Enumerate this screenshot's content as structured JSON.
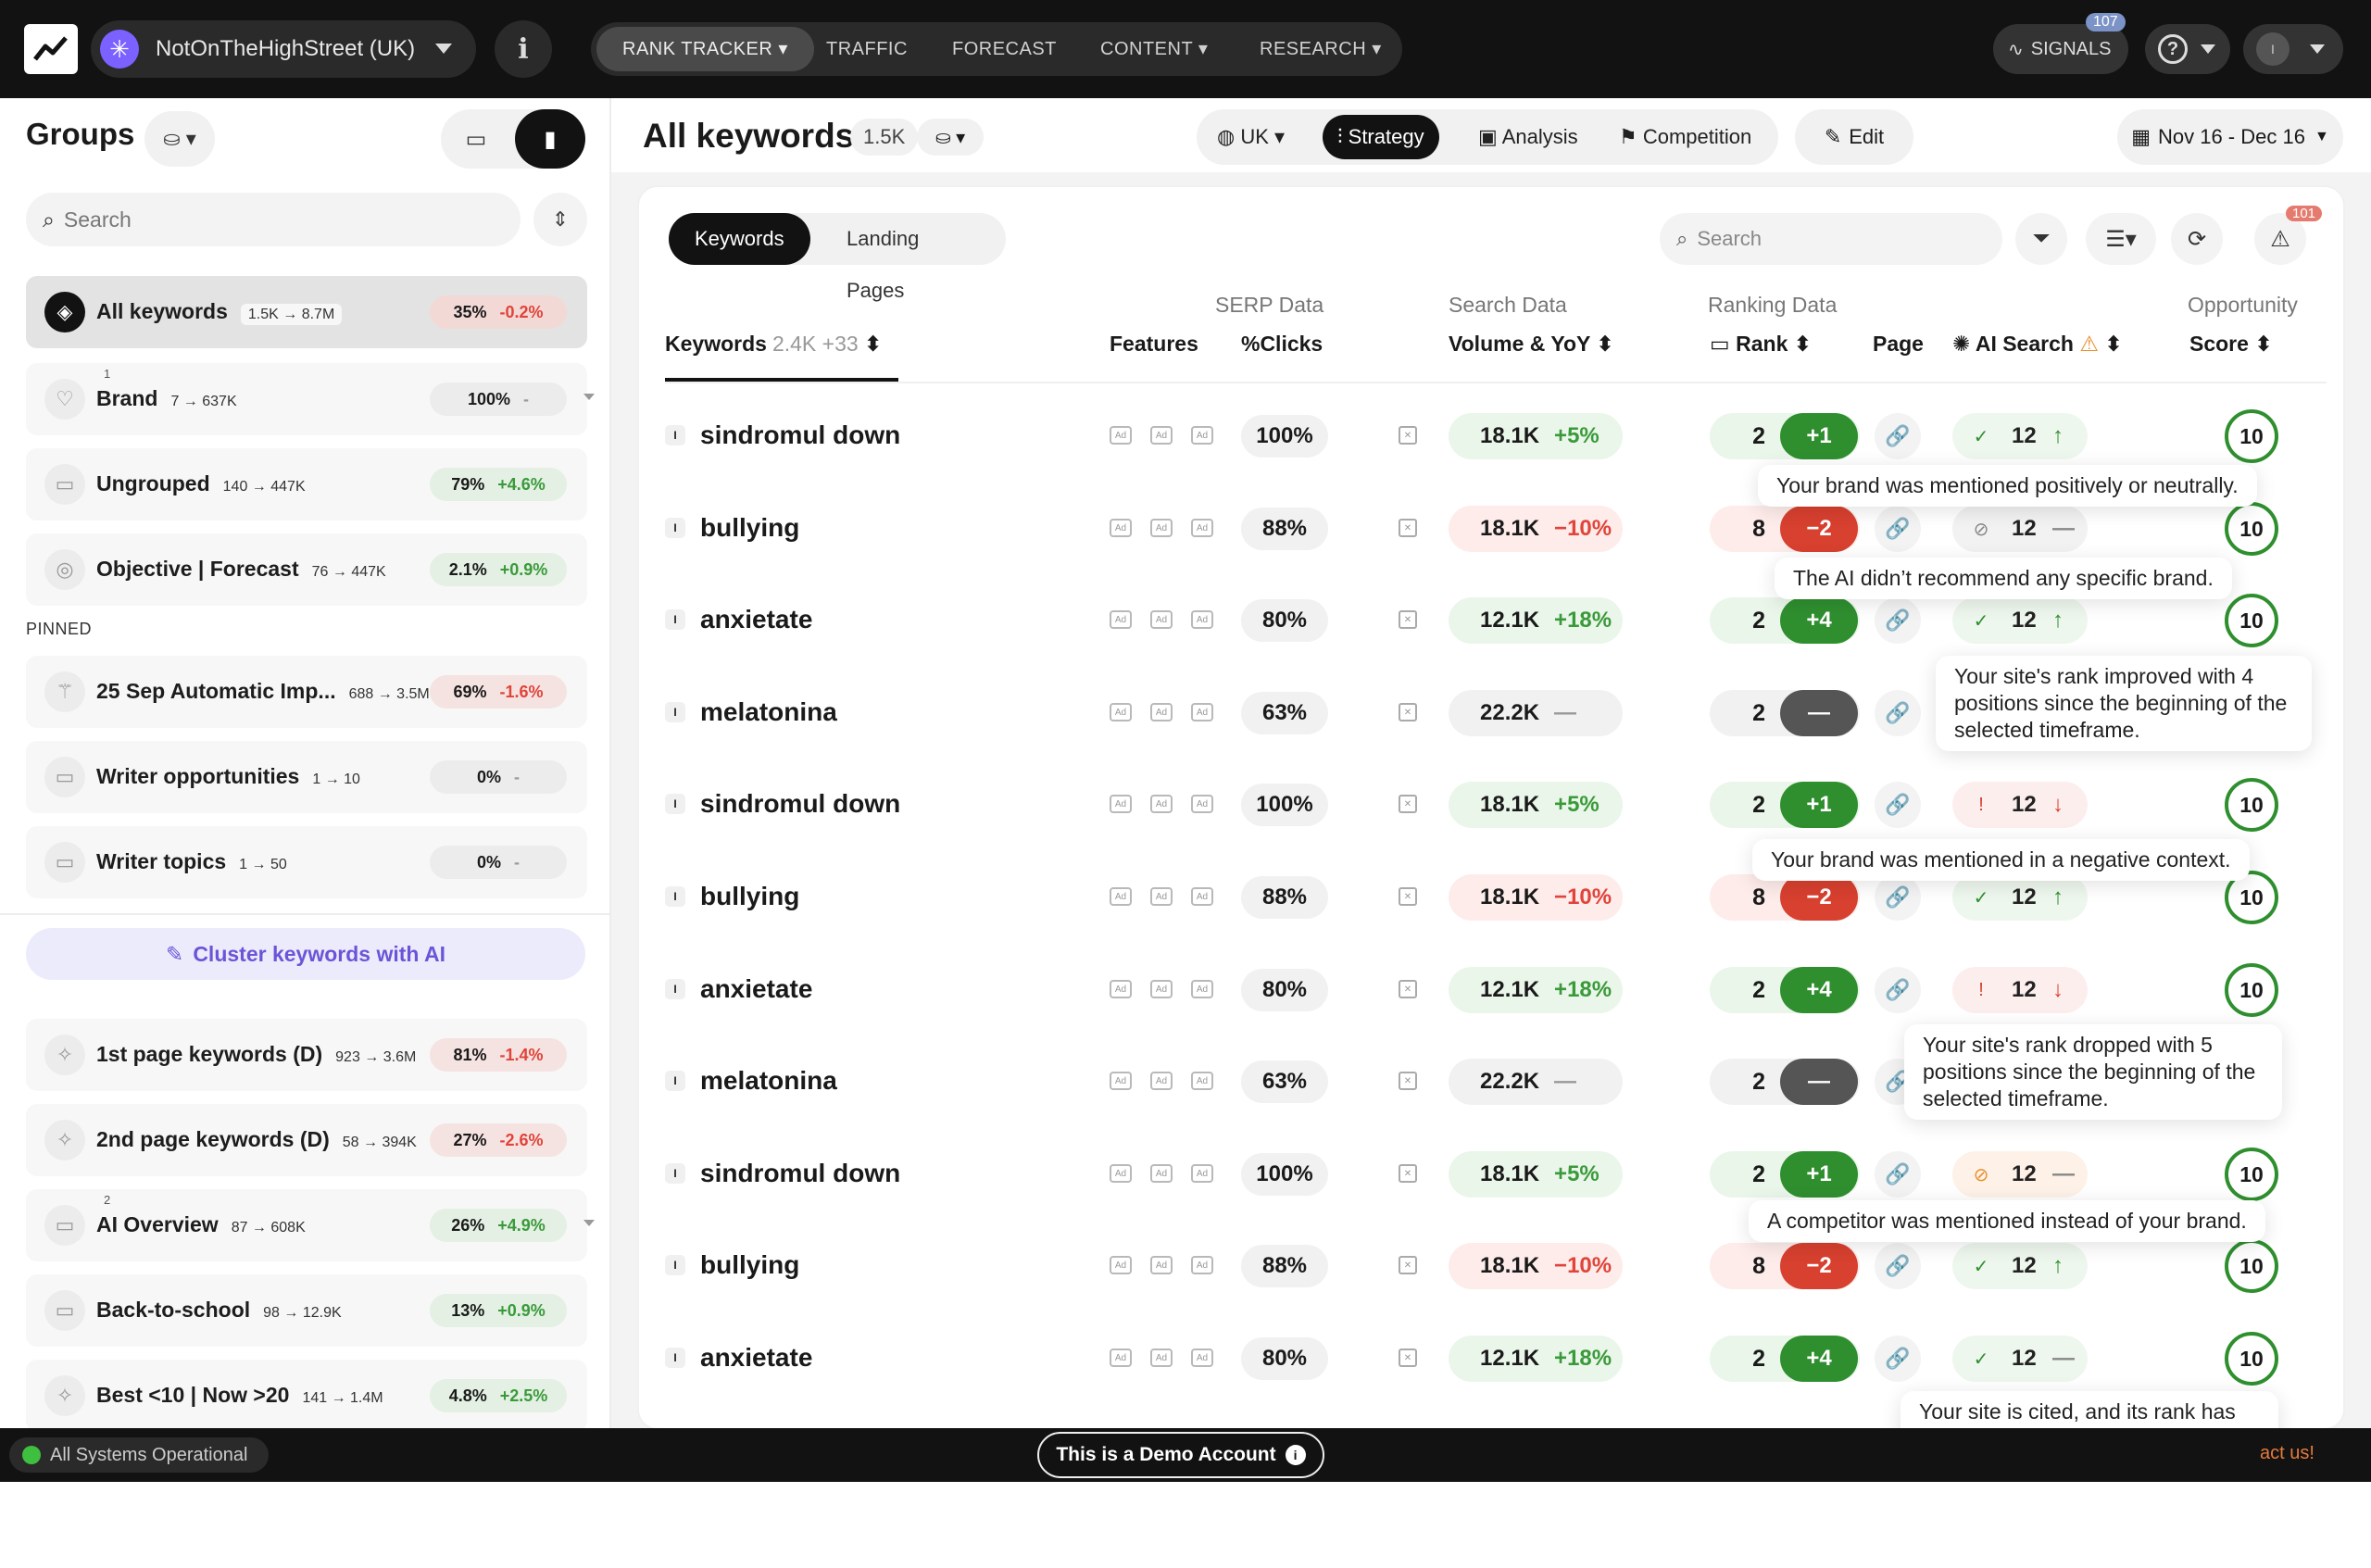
{
  "topbar": {
    "project": "NotOnTheHighStreet (UK)",
    "nav": [
      "RANK TRACKER",
      "TRAFFIC",
      "FORECAST",
      "CONTENT",
      "RESEARCH"
    ],
    "signals_label": "SIGNALS",
    "signals_count": "107"
  },
  "sidebar": {
    "title": "Groups",
    "search_placeholder": "Search",
    "pinned_label": "PINNED",
    "cluster_label": "Cluster keywords with AI",
    "groups": [
      {
        "name": "All keywords",
        "count": "1.5K → 8.7M",
        "pct": "35%",
        "change": "-0.2%",
        "dir": "neg"
      },
      {
        "name": "Brand",
        "count": "7 → 637K",
        "pct": "100%",
        "change": "-",
        "dir": "dash",
        "sup": "1"
      },
      {
        "name": "Ungrouped",
        "count": "140 → 447K",
        "pct": "79%",
        "change": "+4.6%",
        "dir": "pos"
      },
      {
        "name": "Objective | Forecast",
        "count": "76 → 447K",
        "pct": "2.1%",
        "change": "+0.9%",
        "dir": "pos"
      }
    ],
    "pinned": [
      {
        "name": "25 Sep Automatic Imp...",
        "count": "688 → 3.5M",
        "pct": "69%",
        "change": "-1.6%",
        "dir": "neg"
      },
      {
        "name": "Writer opportunities",
        "count": "1 → 10",
        "pct": "0%",
        "change": "-",
        "dir": "dash"
      },
      {
        "name": "Writer topics",
        "count": "1 → 50",
        "pct": "0%",
        "change": "-",
        "dir": "dash"
      }
    ],
    "others": [
      {
        "name": "1st page keywords (D)",
        "count": "923 → 3.6M",
        "pct": "81%",
        "change": "-1.4%",
        "dir": "neg"
      },
      {
        "name": "2nd page keywords (D)",
        "count": "58 → 394K",
        "pct": "27%",
        "change": "-2.6%",
        "dir": "neg"
      },
      {
        "name": "AI Overview",
        "count": "87 → 608K",
        "pct": "26%",
        "change": "+4.9%",
        "dir": "pos",
        "sup": "2"
      },
      {
        "name": "Back-to-school",
        "count": "98 → 12.9K",
        "pct": "13%",
        "change": "+0.9%",
        "dir": "pos"
      },
      {
        "name": "Best <10 | Now >20",
        "count": "141 → 1.4M",
        "pct": "4.8%",
        "change": "+2.5%",
        "dir": "pos"
      }
    ]
  },
  "main": {
    "title": "All keywords",
    "count": "1.5K",
    "country": "UK",
    "modes": [
      "Strategy",
      "Analysis",
      "Competition"
    ],
    "edit_label": "Edit",
    "date_range": "Nov 16 - Dec 16",
    "tabs": [
      "Keywords",
      "Landing Pages"
    ],
    "search_placeholder": "Search",
    "alert_count": "101",
    "column_groups": [
      "SERP Data",
      "Search Data",
      "Ranking Data",
      "Opportunity"
    ],
    "columns": {
      "keywords": "Keywords",
      "keywords_count": "2.4K +33",
      "features": "Features",
      "clicks": "%Clicks",
      "volume": "Volume & YoY",
      "rank": "Rank",
      "page": "Page",
      "ai_search": "AI Search",
      "score": "Score"
    },
    "rows": [
      {
        "kw": "sindromul down",
        "clicks": "100%",
        "vol": "18.1K",
        "yoy": "+5%",
        "vdir": "up",
        "rank": "2",
        "chg": "+1",
        "rdir": "up",
        "ai": "pos",
        "ai_rank": "12",
        "ai_arrow": "↑",
        "ai_adir": "up",
        "score": "10"
      },
      {
        "kw": "bullying",
        "clicks": "88%",
        "vol": "18.1K",
        "yoy": "−10%",
        "vdir": "down",
        "rank": "8",
        "chg": "−2",
        "rdir": "down",
        "ai": "neu",
        "ai_rank": "12",
        "ai_arrow": "—",
        "ai_adir": "flat",
        "score": "10"
      },
      {
        "kw": "anxietate",
        "clicks": "80%",
        "vol": "12.1K",
        "yoy": "+18%",
        "vdir": "up",
        "rank": "2",
        "chg": "+4",
        "rdir": "up",
        "ai": "pos",
        "ai_rank": "12",
        "ai_arrow": "↑",
        "ai_adir": "up",
        "score": "10"
      },
      {
        "kw": "melatonina",
        "clicks": "63%",
        "vol": "22.2K",
        "yoy": "—",
        "vdir": "flat",
        "rank": "2",
        "chg": "—",
        "rdir": "flat",
        "ai": "none",
        "ai_rank": "",
        "ai_arrow": "",
        "ai_adir": "flat",
        "score": "10"
      },
      {
        "kw": "sindromul down",
        "clicks": "100%",
        "vol": "18.1K",
        "yoy": "+5%",
        "vdir": "up",
        "rank": "2",
        "chg": "+1",
        "rdir": "up",
        "ai": "neg",
        "ai_rank": "12",
        "ai_arrow": "↓",
        "ai_adir": "down",
        "score": "10"
      },
      {
        "kw": "bullying",
        "clicks": "88%",
        "vol": "18.1K",
        "yoy": "−10%",
        "vdir": "down",
        "rank": "8",
        "chg": "−2",
        "rdir": "down",
        "ai": "pos",
        "ai_rank": "12",
        "ai_arrow": "↑",
        "ai_adir": "up",
        "score": "10"
      },
      {
        "kw": "anxietate",
        "clicks": "80%",
        "vol": "12.1K",
        "yoy": "+18%",
        "vdir": "up",
        "rank": "2",
        "chg": "+4",
        "rdir": "up",
        "ai": "neg",
        "ai_rank": "12",
        "ai_arrow": "↓",
        "ai_adir": "down",
        "score": "10"
      },
      {
        "kw": "melatonina",
        "clicks": "63%",
        "vol": "22.2K",
        "yoy": "—",
        "vdir": "flat",
        "rank": "2",
        "chg": "—",
        "rdir": "flat",
        "ai": "none",
        "ai_rank": "",
        "ai_arrow": "",
        "ai_adir": "flat",
        "score": ""
      },
      {
        "kw": "sindromul down",
        "clicks": "100%",
        "vol": "18.1K",
        "yoy": "+5%",
        "vdir": "up",
        "rank": "2",
        "chg": "+1",
        "rdir": "up",
        "ai": "comp",
        "ai_rank": "12",
        "ai_arrow": "—",
        "ai_adir": "flat",
        "score": "10"
      },
      {
        "kw": "bullying",
        "clicks": "88%",
        "vol": "18.1K",
        "yoy": "−10%",
        "vdir": "down",
        "rank": "8",
        "chg": "−2",
        "rdir": "down",
        "ai": "pos",
        "ai_rank": "12",
        "ai_arrow": "↑",
        "ai_adir": "up",
        "score": "10"
      },
      {
        "kw": "anxietate",
        "clicks": "80%",
        "vol": "12.1K",
        "yoy": "+18%",
        "vdir": "up",
        "rank": "2",
        "chg": "+4",
        "rdir": "up",
        "ai": "pos",
        "ai_rank": "12",
        "ai_arrow": "—",
        "ai_adir": "flat",
        "score": "10"
      }
    ]
  },
  "tooltips": {
    "t1": "Your brand was mentioned positively or neutrally.",
    "t2": "The AI didn’t recommend any specific brand.",
    "t3": "Your site's rank improved with 4 positions since the beginning of the selected timeframe.",
    "t4": "Your brand was mentioned in a negative context.",
    "t5": "Your site's rank dropped with 5 positions since the beginning of the selected timeframe.",
    "t6": "A competitor was mentioned instead of your brand.",
    "t7": "Your site is cited, and its rank has not changed."
  },
  "statusbar": {
    "status": "All Systems Operational",
    "demo": "This is a Demo Account",
    "contact": "act us!"
  },
  "colors": {
    "dark": "#121212",
    "green": "#2f8f2f",
    "red": "#d8402f",
    "purple": "#6a55d8"
  }
}
